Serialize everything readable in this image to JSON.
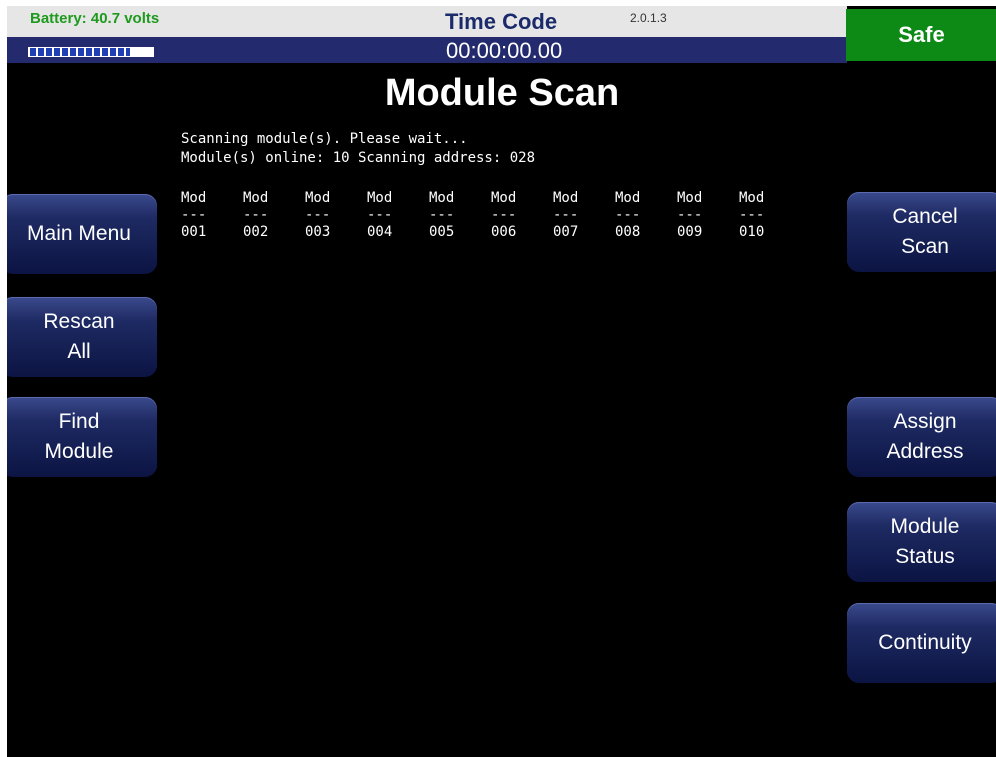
{
  "header": {
    "battery": "Battery: 40.7 volts",
    "battery_level": 0.82,
    "timecode_label": "Time Code",
    "version": "2.0.1.3",
    "timecode": "00:00:00.00",
    "safe_label": "Safe"
  },
  "title": "Module Scan",
  "status": {
    "line1": "Scanning module(s). Please wait...",
    "line2": "Module(s) online: 10 Scanning address: 028"
  },
  "modules": {
    "header": "Mod",
    "divider": "---",
    "addresses": [
      "001",
      "002",
      "003",
      "004",
      "005",
      "006",
      "007",
      "008",
      "009",
      "010"
    ]
  },
  "buttons": {
    "main_menu": "Main Menu",
    "rescan_1": "Rescan",
    "rescan_2": "All",
    "find_1": "Find",
    "find_2": "Module",
    "cancel_1": "Cancel",
    "cancel_2": "Scan",
    "assign_1": "Assign",
    "assign_2": "Address",
    "status_1": "Module",
    "status_2": "Status",
    "continuity": "Continuity"
  },
  "colors": {
    "safe": "#0d8a15",
    "battery_text": "#1e9a1e",
    "navy_bar": "#232a6d",
    "button": "#1e2a63"
  }
}
